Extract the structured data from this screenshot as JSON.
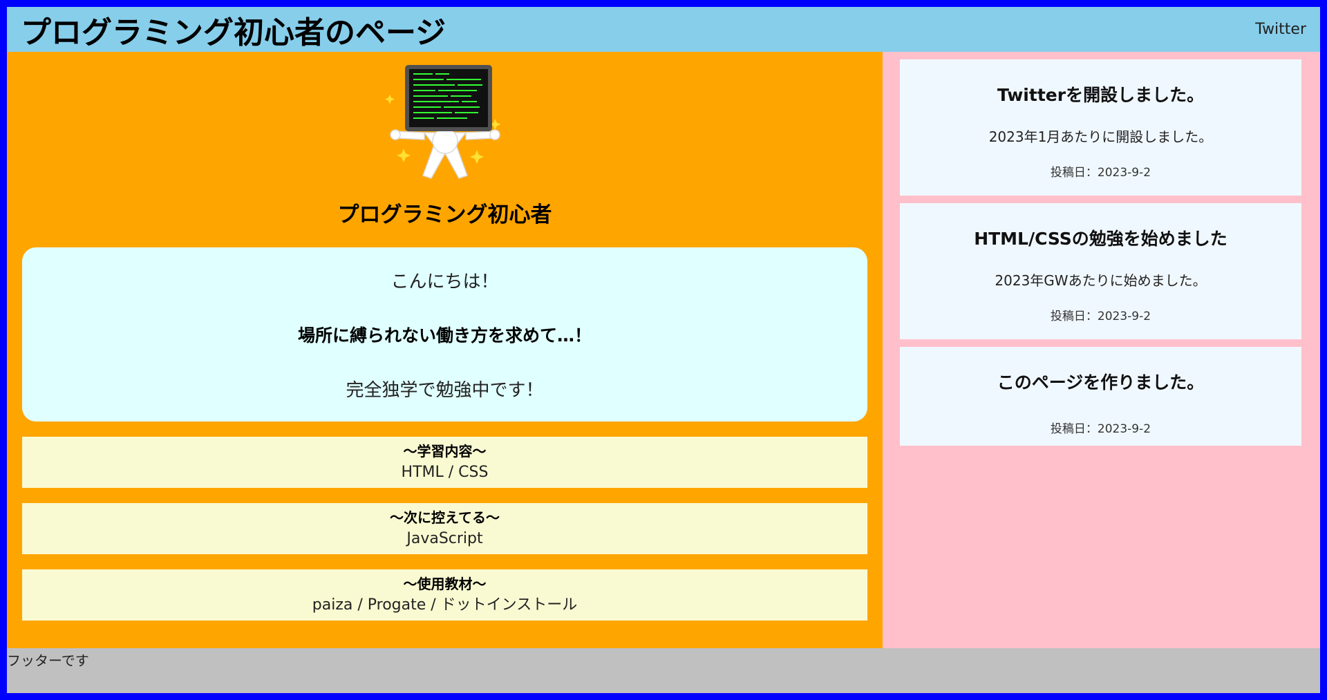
{
  "header": {
    "title": "プログラミング初心者のページ",
    "twitter_label": "Twitter"
  },
  "profile": {
    "name": "プログラミング初心者",
    "avatar_icon": "person-holding-computer-screen-icon"
  },
  "greeting": {
    "line1": "こんにちは！",
    "line2": "場所に縛られない働き方を求めて…！",
    "line3": "完全独学で勉強中です！"
  },
  "info": [
    {
      "heading": "〜学習内容〜",
      "body": "HTML / CSS"
    },
    {
      "heading": "〜次に控えてる〜",
      "body": "JavaScript"
    },
    {
      "heading": "〜使用教材〜",
      "body": "paiza / Progate / ドットインストール"
    }
  ],
  "posts": [
    {
      "title": "Twitterを開設しました。",
      "body": "2023年1月あたりに開設しました。",
      "date": "投稿日：2023-9-2"
    },
    {
      "title": "HTML/CSSの勉強を始めました",
      "body": "2023年GWあたりに始めました。",
      "date": "投稿日：2023-9-2"
    },
    {
      "title": "このページを作りました。",
      "date": "投稿日：2023-9-2"
    }
  ],
  "footer": {
    "text": "フッターです"
  },
  "colors": {
    "border": "#0000ff",
    "header_bg": "#87ceeb",
    "main_bg": "#ffa500",
    "sidebar_bg": "#ffc0cb",
    "greeting_bg": "#e0ffff",
    "info_bg": "#fafad2",
    "post_bg": "#f0f8ff",
    "footer_bg": "#c0c0c0"
  }
}
